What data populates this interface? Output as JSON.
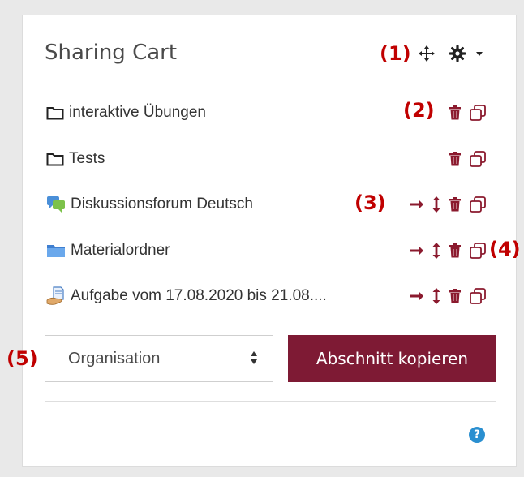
{
  "block": {
    "title": "Sharing Cart"
  },
  "annotations": {
    "a1": "(1)",
    "a2": "(2)",
    "a3": "(3)",
    "a4": "(4)",
    "a5": "(5)"
  },
  "items": [
    {
      "label": "interaktive Übungen",
      "icon": "folder-outline-icon",
      "actions": [
        "delete",
        "copy"
      ]
    },
    {
      "label": "Tests",
      "icon": "folder-outline-icon",
      "actions": [
        "delete",
        "copy"
      ]
    },
    {
      "label": "Diskussionsforum Deutsch",
      "icon": "forum-icon",
      "actions": [
        "move-right",
        "move-updown",
        "delete",
        "copy"
      ]
    },
    {
      "label": "Materialordner",
      "icon": "folder-blue-icon",
      "actions": [
        "move-right",
        "move-updown",
        "delete",
        "copy"
      ]
    },
    {
      "label": "Aufgabe vom 17.08.2020 bis 21.08....",
      "icon": "assignment-icon",
      "actions": [
        "move-right",
        "move-updown",
        "delete",
        "copy"
      ]
    }
  ],
  "section_select": {
    "value": "Organisation"
  },
  "copy_section_button": {
    "label": "Abschnitt kopieren"
  },
  "help": {
    "symbol": "?"
  },
  "colors": {
    "accent": "#7e1a34",
    "annotation": "#c00000",
    "help": "#2a8fd0"
  }
}
